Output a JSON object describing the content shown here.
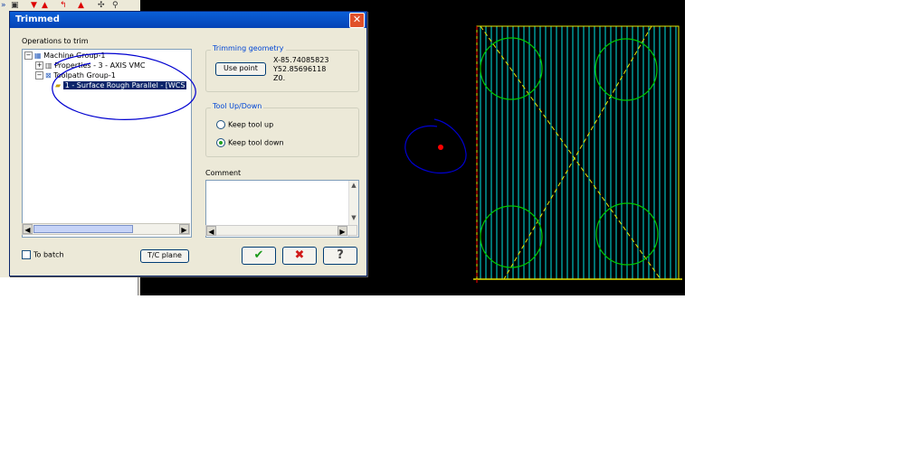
{
  "dialog": {
    "title": "Trimmed",
    "close_symbol": "✕",
    "operations_label": "Operations to trim",
    "tree": [
      {
        "label": "Machine Group-1",
        "expander": "−"
      },
      {
        "label": "Properties - 3 - AXIS VMC",
        "expander": "+"
      },
      {
        "label": "Toolpath Group-1",
        "expander": "−"
      },
      {
        "label": "1 - Surface Rough Parallel - [WCS",
        "expander": ""
      }
    ],
    "trimming_geometry": {
      "legend": "Trimming geometry",
      "button_label": "Use point",
      "x": "X-85.74085823",
      "y": "Y52.85696118",
      "z": "Z0."
    },
    "tool_up_down": {
      "legend": "Tool Up/Down",
      "option_up": "Keep tool up",
      "option_down": "Keep tool down",
      "selected": "down"
    },
    "comment_label": "Comment",
    "to_batch_label": "To batch",
    "plane_button_label": "T/C plane",
    "ok_symbol": "✔",
    "cancel_symbol": "✖",
    "help_symbol": "?"
  },
  "icons": [
    "collapse-arrow-icon",
    "save-icon",
    "arrow-down-icon",
    "arrow-up-icon",
    "toolpath-icon",
    "select-icon"
  ],
  "colors": {
    "titlebar": "#0543b5",
    "dialog_bg": "#ece9d8",
    "viewport_bg": "#000000",
    "toolpath_cyan": "#00e5e5",
    "circle_green": "#00c800",
    "boundary_yellow": "#e6e600",
    "annotation_blue": "#0000d0",
    "point_red": "#ff0000"
  }
}
